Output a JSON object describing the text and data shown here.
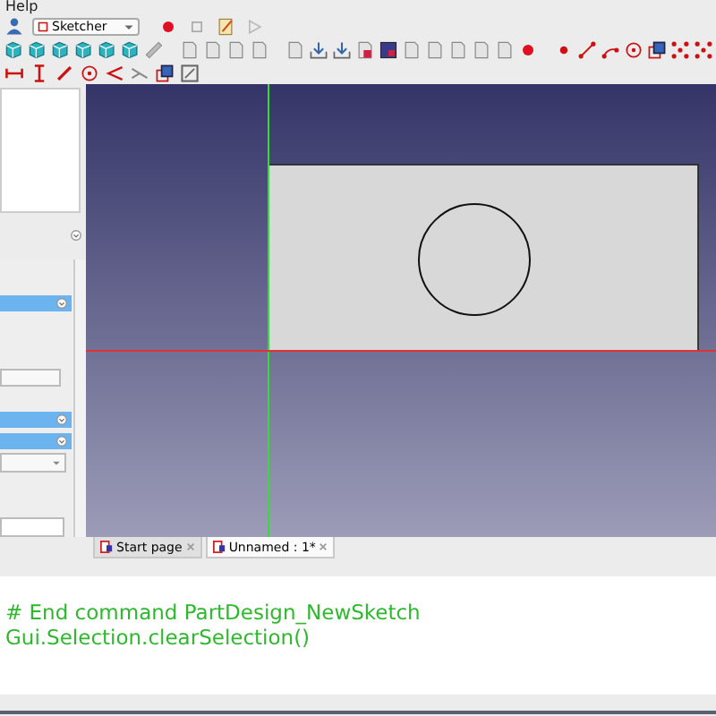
{
  "menu_bar": {
    "items": [
      "Help"
    ]
  },
  "workbench_selector": {
    "value": "Sketcher"
  },
  "document_tabs": [
    {
      "label": "Start page",
      "selected": false
    },
    {
      "label": "Unnamed : 1*",
      "selected": true
    }
  ],
  "python_console": {
    "lines": [
      "# End command PartDesign_NewSketch",
      "Gui.Selection.clearSelection()"
    ]
  }
}
